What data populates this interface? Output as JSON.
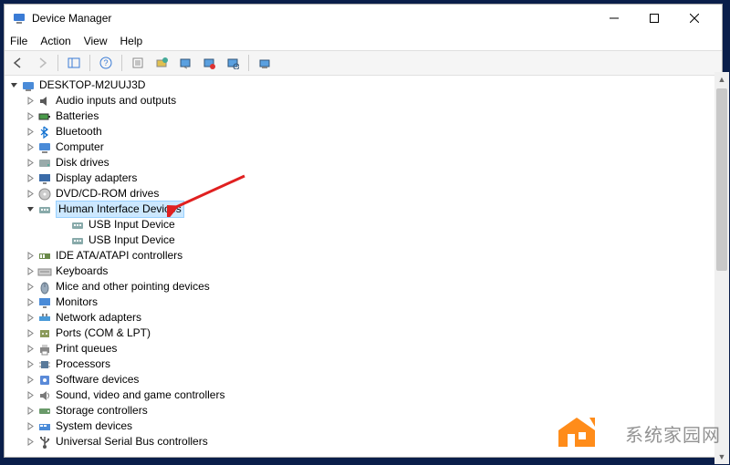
{
  "window": {
    "title": "Device Manager"
  },
  "menu": {
    "file": "File",
    "action": "Action",
    "view": "View",
    "help": "Help"
  },
  "root": {
    "name": "DESKTOP-M2UUJ3D"
  },
  "categories": [
    {
      "label": "Audio inputs and outputs",
      "icon": "audio"
    },
    {
      "label": "Batteries",
      "icon": "battery"
    },
    {
      "label": "Bluetooth",
      "icon": "bluetooth"
    },
    {
      "label": "Computer",
      "icon": "computer"
    },
    {
      "label": "Disk drives",
      "icon": "disk"
    },
    {
      "label": "Display adapters",
      "icon": "display"
    },
    {
      "label": "DVD/CD-ROM drives",
      "icon": "dvd"
    },
    {
      "label": "Human Interface Devices",
      "icon": "hid",
      "expanded": true,
      "selected": true,
      "children": [
        {
          "label": "USB Input Device",
          "icon": "hid"
        },
        {
          "label": "USB Input Device",
          "icon": "hid"
        }
      ]
    },
    {
      "label": "IDE ATA/ATAPI controllers",
      "icon": "ide"
    },
    {
      "label": "Keyboards",
      "icon": "keyboard"
    },
    {
      "label": "Mice and other pointing devices",
      "icon": "mouse"
    },
    {
      "label": "Monitors",
      "icon": "monitor"
    },
    {
      "label": "Network adapters",
      "icon": "network"
    },
    {
      "label": "Ports (COM & LPT)",
      "icon": "ports"
    },
    {
      "label": "Print queues",
      "icon": "printer"
    },
    {
      "label": "Processors",
      "icon": "cpu"
    },
    {
      "label": "Software devices",
      "icon": "software"
    },
    {
      "label": "Sound, video and game controllers",
      "icon": "sound"
    },
    {
      "label": "Storage controllers",
      "icon": "storage"
    },
    {
      "label": "System devices",
      "icon": "system"
    },
    {
      "label": "Universal Serial Bus controllers",
      "icon": "usb"
    }
  ],
  "watermark": "系统家园网"
}
